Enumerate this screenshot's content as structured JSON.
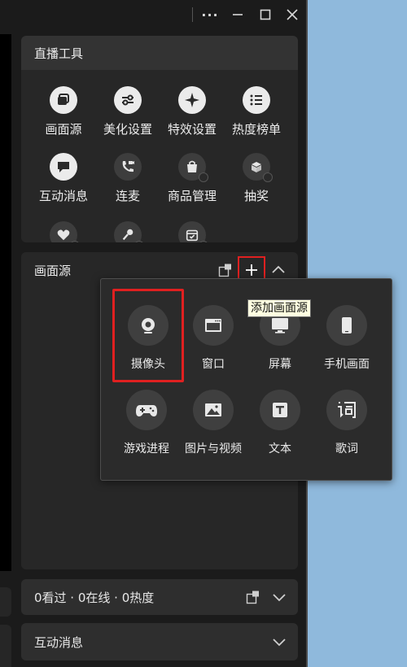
{
  "titlebar": {
    "more_icon": "more-dots-icon",
    "minimize_icon": "minimize-icon",
    "maximize_icon": "maximize-icon",
    "close_icon": "close-icon"
  },
  "tools": {
    "title": "直播工具",
    "items": [
      {
        "label": "画面源",
        "icon": "layers-icon"
      },
      {
        "label": "美化设置",
        "icon": "sliders-icon"
      },
      {
        "label": "特效设置",
        "icon": "sparkle-icon"
      },
      {
        "label": "热度榜单",
        "icon": "list-icon"
      },
      {
        "label": "互动消息",
        "icon": "chat-icon"
      },
      {
        "label": "连麦",
        "icon": "video-call-icon"
      },
      {
        "label": "商品管理",
        "icon": "shopping-bag-icon"
      },
      {
        "label": "抽奖",
        "icon": "gift-box-icon"
      },
      {
        "label": "",
        "icon": "heart-icon"
      },
      {
        "label": "",
        "icon": "microphone-icon"
      },
      {
        "label": "",
        "icon": "calendar-check-icon"
      }
    ]
  },
  "source": {
    "title": "画面源",
    "add_tooltip": "添加画面源"
  },
  "popup": {
    "items": [
      {
        "label": "摄像头",
        "icon": "webcam-icon"
      },
      {
        "label": "窗口",
        "icon": "window-icon"
      },
      {
        "label": "屏幕",
        "icon": "monitor-icon"
      },
      {
        "label": "手机画面",
        "icon": "phone-icon"
      },
      {
        "label": "游戏进程",
        "icon": "gamepad-icon"
      },
      {
        "label": "图片与视频",
        "icon": "image-icon"
      },
      {
        "label": "文本",
        "icon": "text-icon"
      },
      {
        "label": "歌词",
        "icon": "lyrics-icon"
      }
    ]
  },
  "stats": {
    "text": "0看过 · 0在线 · 0热度"
  },
  "interact": {
    "title": "互动消息"
  }
}
